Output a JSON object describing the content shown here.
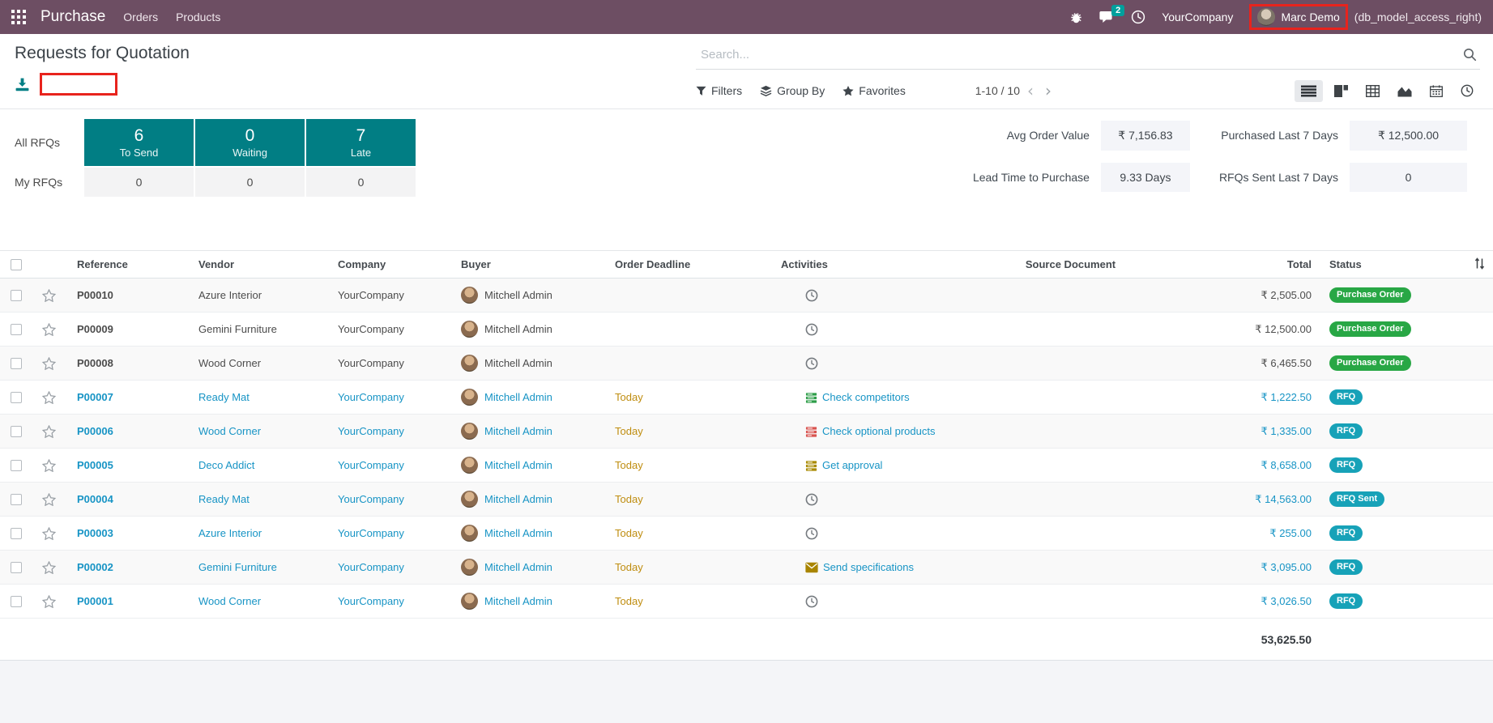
{
  "navbar": {
    "app_name": "Purchase",
    "menus": {
      "orders": "Orders",
      "products": "Products"
    },
    "systray": {
      "icons": [
        "apps-grid-icon",
        "bug-icon",
        "messages-icon",
        "activities-clock-icon"
      ],
      "messages_count": "2",
      "company": "YourCompany",
      "user_name": "Marc Demo",
      "db_suffix": "(db_model_access_right)"
    }
  },
  "control_panel": {
    "title": "Requests for Quotation",
    "export_icon": "download-icon",
    "search": {
      "placeholder": "Search...",
      "icon": "search-icon"
    },
    "filters_label": "Filters",
    "group_by_label": "Group By",
    "favorites_label": "Favorites",
    "pager": {
      "text": "1-10 / 10",
      "prev": "‹",
      "next": "›"
    },
    "view_switcher": [
      "list-view-icon",
      "kanban-view-icon",
      "pivot-view-icon",
      "graph-view-icon",
      "calendar-view-icon",
      "activity-view-icon"
    ],
    "active_view": "list"
  },
  "dashboard": {
    "row_labels": {
      "all": "All RFQs",
      "my": "My RFQs"
    },
    "cards": [
      {
        "label": "To Send",
        "all": "6",
        "my": "0"
      },
      {
        "label": "Waiting",
        "all": "0",
        "my": "0"
      },
      {
        "label": "Late",
        "all": "7",
        "my": "0"
      }
    ],
    "stats": [
      {
        "label": "Avg Order Value",
        "value": "₹ 7,156.83"
      },
      {
        "label": "Purchased Last 7 Days",
        "value": "₹ 12,500.00"
      },
      {
        "label": "Lead Time to Purchase",
        "value": "9.33 Days"
      },
      {
        "label": "RFQs Sent Last 7 Days",
        "value": "0"
      }
    ]
  },
  "table": {
    "columns": [
      "Reference",
      "Vendor",
      "Company",
      "Buyer",
      "Order Deadline",
      "Activities",
      "Source Document",
      "Total",
      "Status"
    ],
    "rows": [
      {
        "reference": "P00010",
        "vendor": "Azure Interior",
        "company": "YourCompany",
        "buyer": "Mitchell Admin",
        "deadline": "",
        "activity_icon": "clock",
        "activity_label": "",
        "total": "₹ 2,505.00",
        "status": "Purchase Order",
        "status_type": "success",
        "highlighted": false
      },
      {
        "reference": "P00009",
        "vendor": "Gemini Furniture",
        "company": "YourCompany",
        "buyer": "Mitchell Admin",
        "deadline": "",
        "activity_icon": "clock",
        "activity_label": "",
        "total": "₹ 12,500.00",
        "status": "Purchase Order",
        "status_type": "success",
        "highlighted": false
      },
      {
        "reference": "P00008",
        "vendor": "Wood Corner",
        "company": "YourCompany",
        "buyer": "Mitchell Admin",
        "deadline": "",
        "activity_icon": "clock",
        "activity_label": "",
        "total": "₹ 6,465.50",
        "status": "Purchase Order",
        "status_type": "success",
        "highlighted": false
      },
      {
        "reference": "P00007",
        "vendor": "Ready Mat",
        "company": "YourCompany",
        "buyer": "Mitchell Admin",
        "deadline": "Today",
        "activity_icon": "tasks-green",
        "activity_label": "Check competitors",
        "total": "₹ 1,222.50",
        "status": "RFQ",
        "status_type": "info",
        "highlighted": true
      },
      {
        "reference": "P00006",
        "vendor": "Wood Corner",
        "company": "YourCompany",
        "buyer": "Mitchell Admin",
        "deadline": "Today",
        "activity_icon": "tasks-red",
        "activity_label": "Check optional products",
        "total": "₹ 1,335.00",
        "status": "RFQ",
        "status_type": "info",
        "highlighted": true
      },
      {
        "reference": "P00005",
        "vendor": "Deco Addict",
        "company": "YourCompany",
        "buyer": "Mitchell Admin",
        "deadline": "Today",
        "activity_icon": "tasks-yellow",
        "activity_label": "Get approval",
        "total": "₹ 8,658.00",
        "status": "RFQ",
        "status_type": "info",
        "highlighted": true
      },
      {
        "reference": "P00004",
        "vendor": "Ready Mat",
        "company": "YourCompany",
        "buyer": "Mitchell Admin",
        "deadline": "Today",
        "activity_icon": "clock",
        "activity_label": "",
        "total": "₹ 14,563.00",
        "status": "RFQ Sent",
        "status_type": "info",
        "highlighted": true
      },
      {
        "reference": "P00003",
        "vendor": "Azure Interior",
        "company": "YourCompany",
        "buyer": "Mitchell Admin",
        "deadline": "Today",
        "activity_icon": "clock",
        "activity_label": "",
        "total": "₹ 255.00",
        "status": "RFQ",
        "status_type": "info",
        "highlighted": true
      },
      {
        "reference": "P00002",
        "vendor": "Gemini Furniture",
        "company": "YourCompany",
        "buyer": "Mitchell Admin",
        "deadline": "Today",
        "activity_icon": "envelope",
        "activity_label": "Send specifications",
        "total": "₹ 3,095.00",
        "status": "RFQ",
        "status_type": "info",
        "highlighted": true
      },
      {
        "reference": "P00001",
        "vendor": "Wood Corner",
        "company": "YourCompany",
        "buyer": "Mitchell Admin",
        "deadline": "Today",
        "activity_icon": "clock",
        "activity_label": "",
        "total": "₹ 3,026.50",
        "status": "RFQ",
        "status_type": "info",
        "highlighted": true
      }
    ],
    "footer_total": "53,625.50"
  },
  "colors": {
    "navbar_bg": "#6d4e63",
    "kpi_teal": "#017e84",
    "badge_success": "#28a745",
    "badge_info": "#17a2b8",
    "row_link": "#1794c5",
    "deadline_warning": "#bf8d10",
    "annotation_red": "#e8231d",
    "systray_badge": "#00A09D"
  }
}
